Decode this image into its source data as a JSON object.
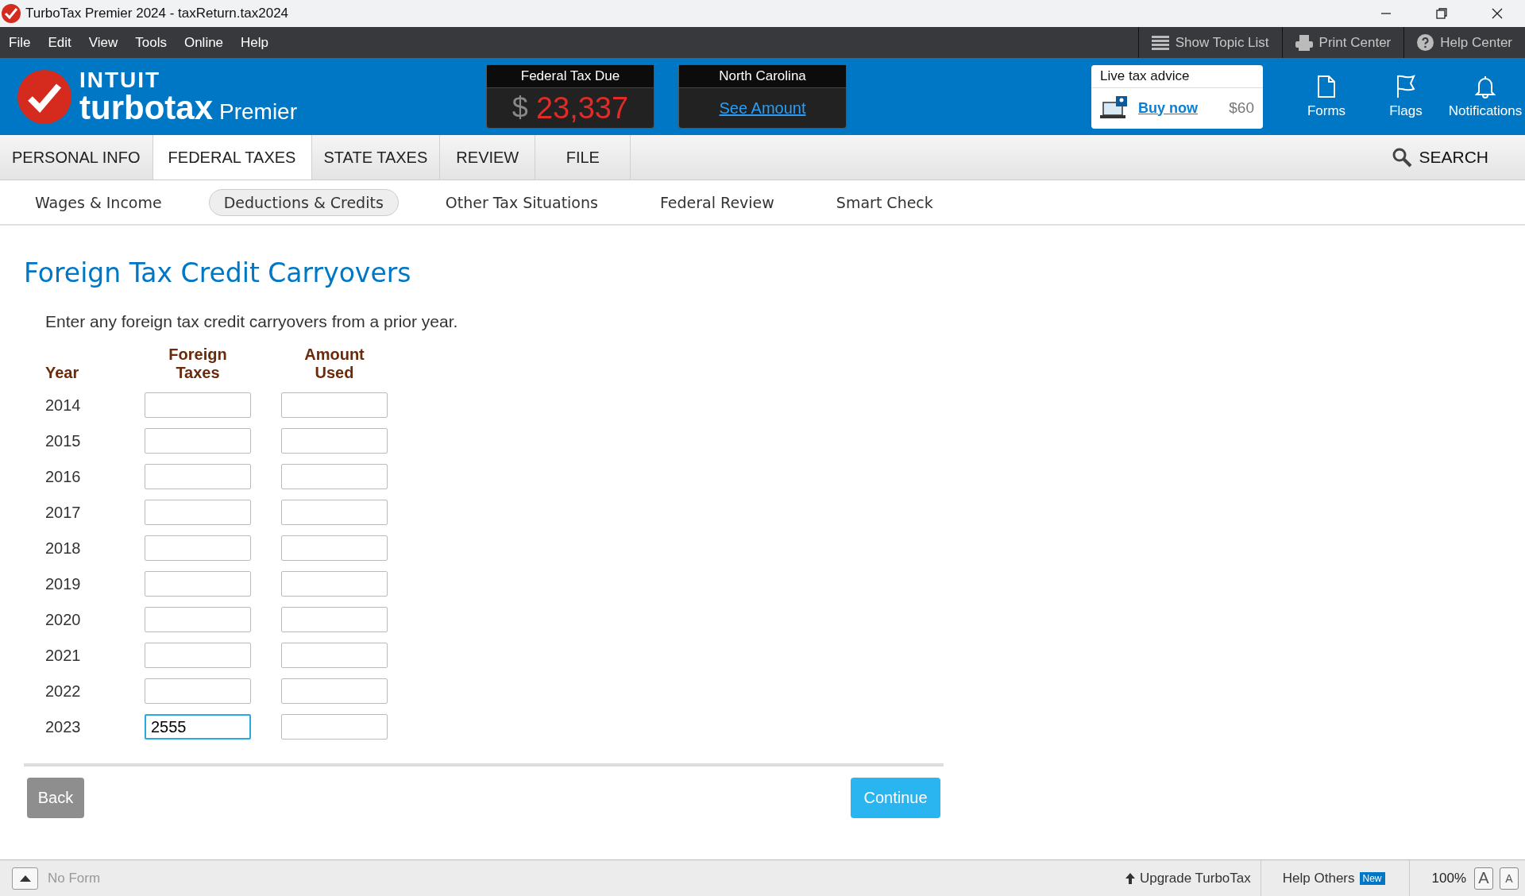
{
  "window": {
    "title": "TurboTax Premier 2024 - taxReturn.tax2024"
  },
  "menu": [
    "File",
    "Edit",
    "View",
    "Tools",
    "Online",
    "Help"
  ],
  "toolbar": [
    {
      "kind": "list",
      "label": "Show Topic List"
    },
    {
      "kind": "print",
      "label": "Print Center"
    },
    {
      "kind": "help",
      "label": "Help Center"
    }
  ],
  "logo": {
    "brand": "INTUIT",
    "product": "turbotax",
    "edition": "Premier"
  },
  "federal": {
    "title": "Federal Tax Due",
    "currency": "$",
    "amount": "23,337"
  },
  "state": {
    "title": "North Carolina",
    "link": "See Amount"
  },
  "advice": {
    "title": "Live tax advice",
    "link": "Buy now",
    "price": "$60"
  },
  "header_icons": [
    {
      "kind": "forms",
      "label": "Forms"
    },
    {
      "kind": "flags",
      "label": "Flags"
    },
    {
      "kind": "bell",
      "label": "Notifications"
    }
  ],
  "tabs": [
    {
      "label": "PERSONAL INFO",
      "selected": false
    },
    {
      "label": "FEDERAL TAXES",
      "selected": true
    },
    {
      "label": "STATE TAXES",
      "selected": false
    },
    {
      "label": "REVIEW",
      "selected": false
    },
    {
      "label": "FILE",
      "selected": false
    }
  ],
  "search": {
    "label": "SEARCH"
  },
  "subtabs": [
    {
      "label": "Wages & Income",
      "selected": false
    },
    {
      "label": "Deductions & Credits",
      "selected": true
    },
    {
      "label": "Other Tax Situations",
      "selected": false
    },
    {
      "label": "Federal Review",
      "selected": false
    },
    {
      "label": "Smart Check",
      "selected": false
    }
  ],
  "page": {
    "heading": "Foreign Tax Credit Carryovers",
    "intro": "Enter any foreign tax credit carryovers from a prior year.",
    "columns": [
      "Year",
      "Foreign Taxes",
      "Amount Used"
    ],
    "rows": [
      {
        "year": "2014",
        "foreign_taxes": {
          "focused": false
        },
        "amount_used": {
          "focused": false
        }
      },
      {
        "year": "2015",
        "foreign_taxes": {
          "focused": false
        },
        "amount_used": {
          "focused": false
        }
      },
      {
        "year": "2016",
        "foreign_taxes": {
          "focused": false
        },
        "amount_used": {
          "focused": false
        }
      },
      {
        "year": "2017",
        "foreign_taxes": {
          "focused": false
        },
        "amount_used": {
          "focused": false
        }
      },
      {
        "year": "2018",
        "foreign_taxes": {
          "focused": false
        },
        "amount_used": {
          "focused": false
        }
      },
      {
        "year": "2019",
        "foreign_taxes": {
          "focused": false
        },
        "amount_used": {
          "focused": false
        }
      },
      {
        "year": "2020",
        "foreign_taxes": {
          "focused": false
        },
        "amount_used": {
          "focused": false
        }
      },
      {
        "year": "2021",
        "foreign_taxes": {
          "focused": false
        },
        "amount_used": {
          "focused": false
        }
      },
      {
        "year": "2022",
        "foreign_taxes": {
          "focused": false
        },
        "amount_used": {
          "focused": false
        }
      },
      {
        "year": "2023",
        "foreign_taxes": {
          "value": "2555",
          "focused": true
        },
        "amount_used": {
          "focused": false
        }
      }
    ],
    "back": "Back",
    "continue": "Continue"
  },
  "status_bar": {
    "form": "No Form",
    "upgrade": "Upgrade TurboTax",
    "help_others": "Help Others",
    "badge": "New",
    "zoom": "100%",
    "font_large": "A",
    "font_small": "A"
  }
}
